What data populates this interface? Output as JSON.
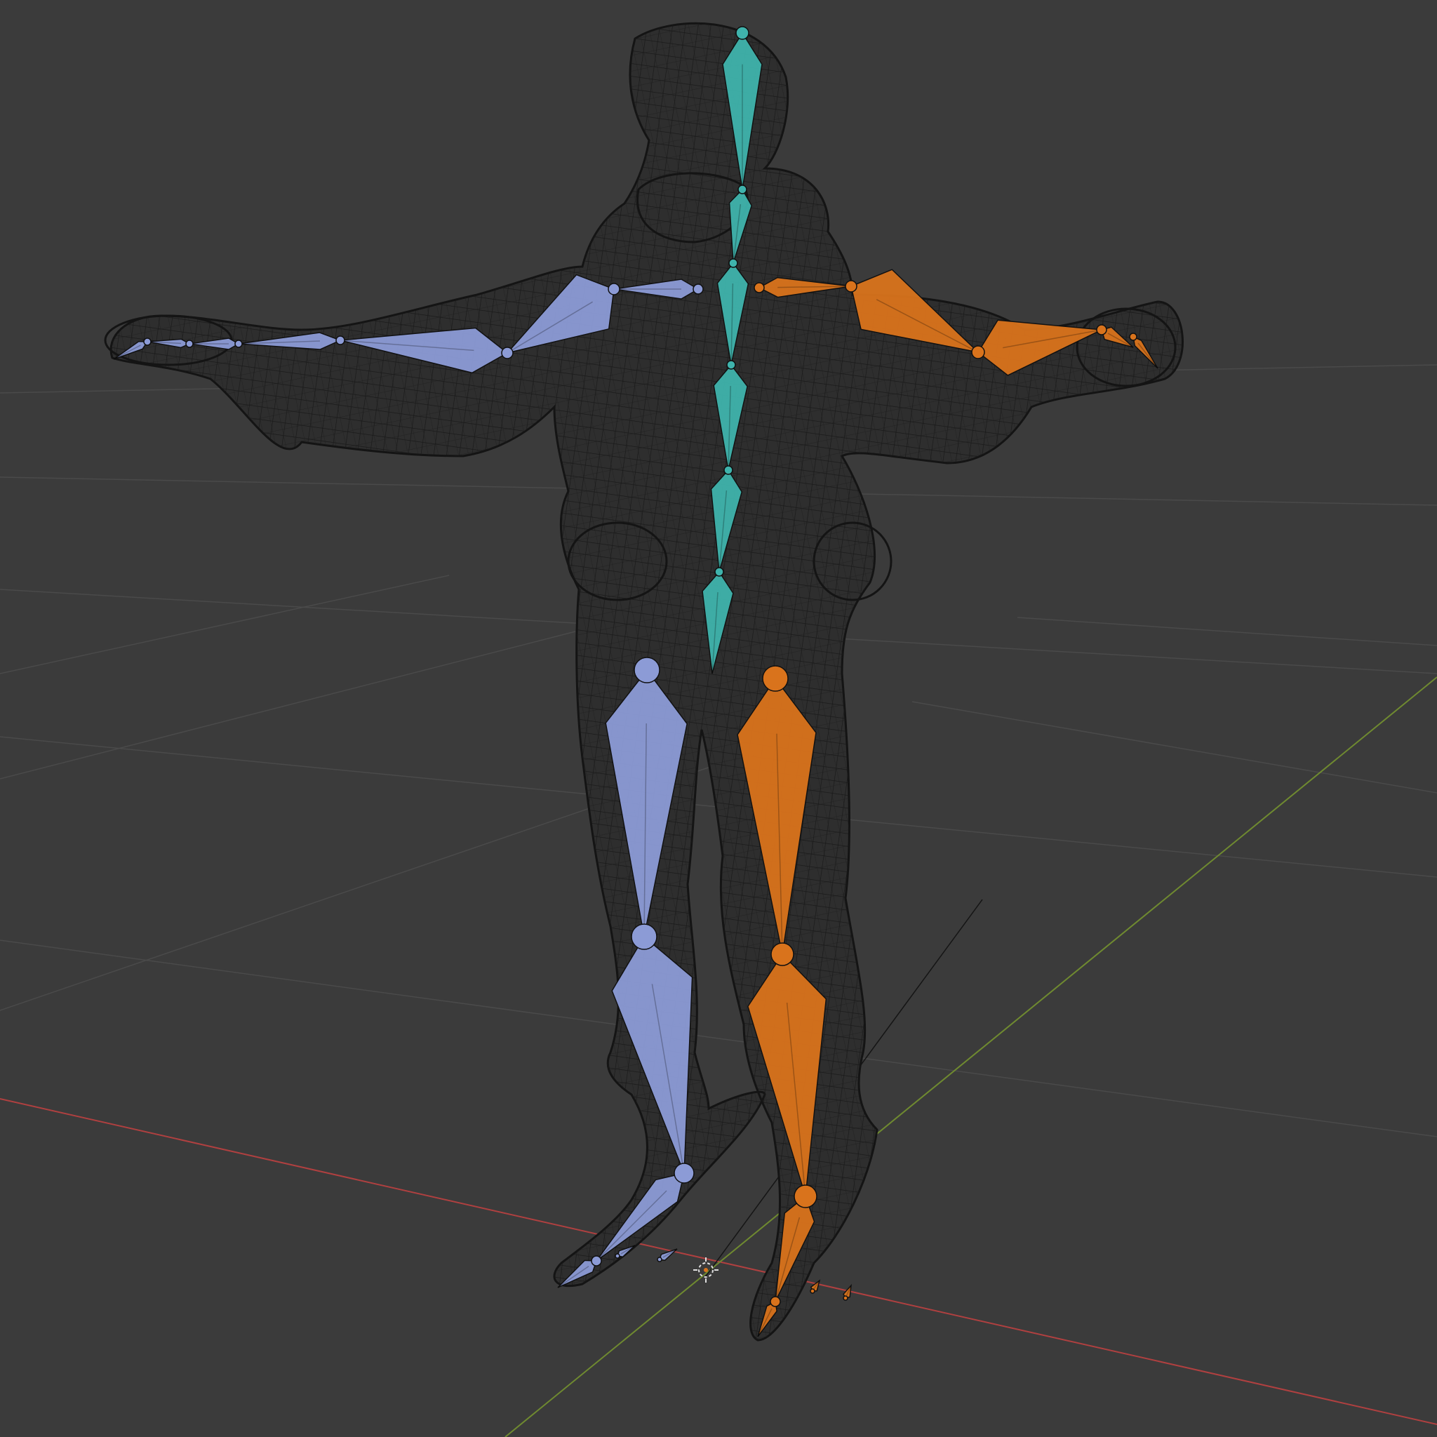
{
  "viewport": {
    "background": "#3b3b3b",
    "grid_color": "#4a4a4a",
    "x_axis_color": "#b04040",
    "y_axis_color": "#6f8a30",
    "mesh_wire_color": "#1a1a1a",
    "mesh_fill_color": "#2f2f2f"
  },
  "armature": {
    "spine_color": "#3fb3ac",
    "left_color": "#8c9bd6",
    "right_color": "#d9731c",
    "joint_outline": "#101010"
  },
  "icons": {
    "origin": "3d-cursor-icon"
  }
}
